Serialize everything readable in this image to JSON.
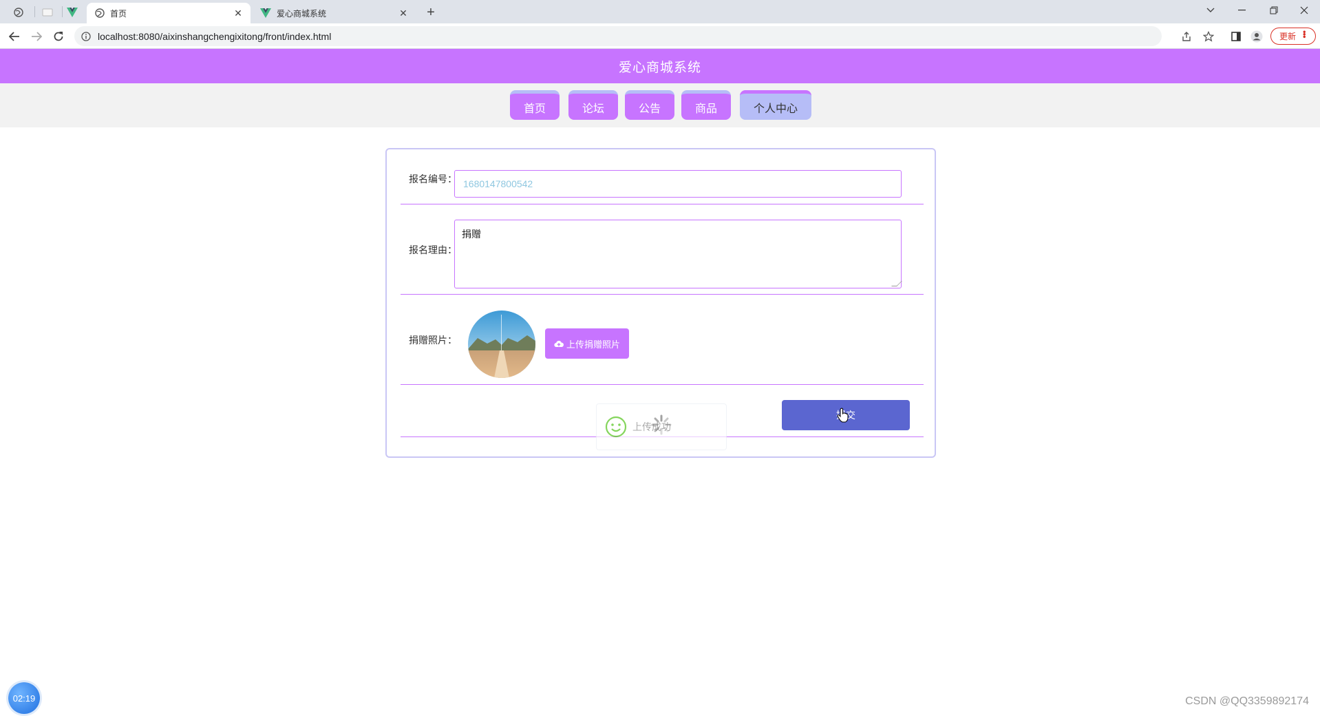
{
  "browser": {
    "tabs": [
      {
        "title": "首页",
        "active": true
      },
      {
        "title": "爱心商城系统",
        "active": false
      }
    ],
    "url": "localhost:8080/aixinshangchengixitong/front/index.html",
    "update_label": "更新"
  },
  "header": {
    "title": "爱心商城系统"
  },
  "nav": {
    "items": [
      {
        "label": "首页"
      },
      {
        "label": "论坛"
      },
      {
        "label": "公告"
      },
      {
        "label": "商品"
      },
      {
        "label": "个人中心",
        "active": true
      }
    ]
  },
  "form": {
    "number": {
      "label": "报名编号：",
      "value": "1680147800542"
    },
    "reason": {
      "label": "报名理由：",
      "value": "捐赠"
    },
    "photo": {
      "label": "捐赠照片：",
      "upload_label": "上传捐赠照片"
    },
    "submit_label": "提交"
  },
  "toast": {
    "text": "上传成功"
  },
  "overlay": {
    "timer": "02:19",
    "watermark": "CSDN @QQ3359892174"
  },
  "colors": {
    "accent": "#c774ff",
    "nav_active": "#b6bdf7",
    "submit": "#5b66d0",
    "success": "#52c41a"
  }
}
